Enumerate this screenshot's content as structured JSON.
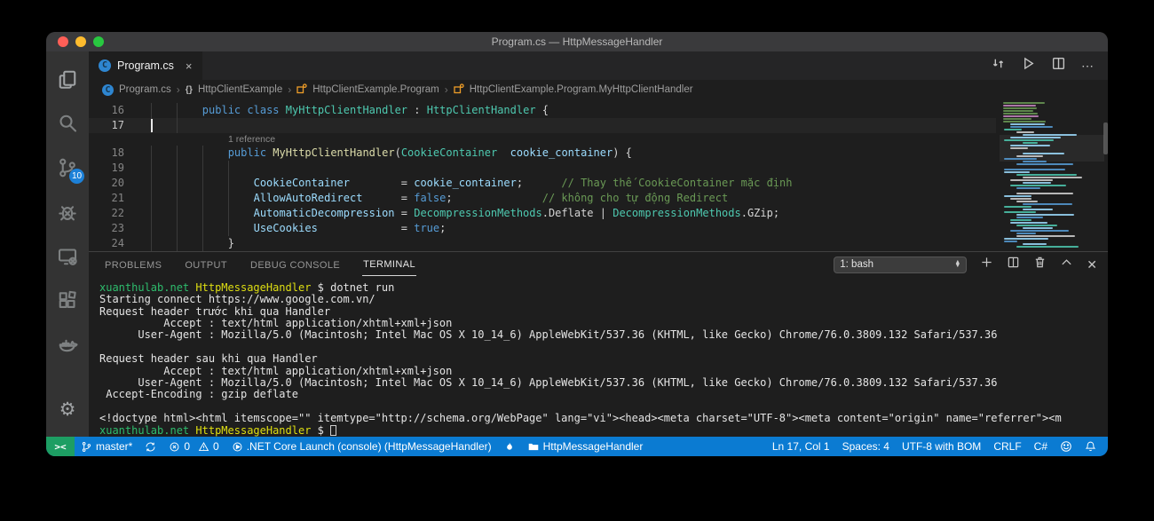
{
  "window": {
    "title": "Program.cs — HttpMessageHandler"
  },
  "tab": {
    "label": "Program.cs",
    "close": "×"
  },
  "editor_actions": {
    "more": "⋯"
  },
  "breadcrumb": {
    "file": "Program.cs",
    "namespace": "HttpClientExample",
    "cls1": "HttpClientExample.Program",
    "cls2": "HttpClientExample.Program.MyHttpClientHandler",
    "curly": "{}",
    "sep": "›"
  },
  "activity": {
    "scm_badge": "10",
    "gear": "⚙"
  },
  "editor": {
    "rows": [
      {
        "num": "16",
        "guides": 2,
        "segs": [
          [
            "pl",
            "        "
          ],
          [
            "kw",
            "public"
          ],
          [
            "pl",
            " "
          ],
          [
            "kw",
            "class"
          ],
          [
            "pl",
            " "
          ],
          [
            "ty",
            "MyHttpClientHandler"
          ],
          [
            "pl",
            " : "
          ],
          [
            "ty",
            "HttpClientHandler"
          ],
          [
            "pl",
            " {"
          ]
        ]
      },
      {
        "num": "17",
        "guides": 2,
        "active": true,
        "cursor": true,
        "segs": []
      },
      {
        "lens": "1 reference"
      },
      {
        "num": "18",
        "guides": 3,
        "segs": [
          [
            "pl",
            "            "
          ],
          [
            "kw",
            "public"
          ],
          [
            "pl",
            " "
          ],
          [
            "fn",
            "MyHttpClientHandler"
          ],
          [
            "pl",
            "("
          ],
          [
            "ty",
            "CookieContainer"
          ],
          [
            "pl",
            "  "
          ],
          [
            "var",
            "cookie_container"
          ],
          [
            "pl",
            ") {"
          ]
        ]
      },
      {
        "num": "19",
        "guides": 4,
        "segs": []
      },
      {
        "num": "20",
        "guides": 4,
        "segs": [
          [
            "pl",
            "                "
          ],
          [
            "var",
            "CookieContainer"
          ],
          [
            "pl",
            "        = "
          ],
          [
            "var",
            "cookie_container"
          ],
          [
            "pl",
            ";      "
          ],
          [
            "cm",
            "// Thay thế CookieContainer mặc định"
          ]
        ]
      },
      {
        "num": "21",
        "guides": 4,
        "segs": [
          [
            "pl",
            "                "
          ],
          [
            "var",
            "AllowAutoRedirect"
          ],
          [
            "pl",
            "      = "
          ],
          [
            "kw",
            "false"
          ],
          [
            "pl",
            ";              "
          ],
          [
            "cm",
            "// không cho tự động Redirect"
          ]
        ]
      },
      {
        "num": "22",
        "guides": 4,
        "segs": [
          [
            "pl",
            "                "
          ],
          [
            "var",
            "AutomaticDecompression"
          ],
          [
            "pl",
            " = "
          ],
          [
            "ty",
            "DecompressionMethods"
          ],
          [
            "pl",
            ".Deflate | "
          ],
          [
            "ty",
            "DecompressionMethods"
          ],
          [
            "pl",
            ".GZip;"
          ]
        ]
      },
      {
        "num": "23",
        "guides": 4,
        "segs": [
          [
            "pl",
            "                "
          ],
          [
            "var",
            "UseCookies"
          ],
          [
            "pl",
            "             = "
          ],
          [
            "kw",
            "true"
          ],
          [
            "pl",
            ";"
          ]
        ]
      },
      {
        "num": "24",
        "guides": 3,
        "segs": [
          [
            "pl",
            "            }"
          ]
        ]
      }
    ]
  },
  "panel": {
    "tabs": [
      "PROBLEMS",
      "OUTPUT",
      "DEBUG CONSOLE",
      "TERMINAL"
    ],
    "active_tab": "TERMINAL",
    "shell_select": "1: bash"
  },
  "terminal": {
    "lines": [
      {
        "segs": [
          [
            "g",
            "xuanthulab.net"
          ],
          [
            "w",
            " "
          ],
          [
            "y",
            "HttpMessageHandler"
          ],
          [
            "w",
            " $ dotnet run"
          ]
        ]
      },
      {
        "segs": [
          [
            "w",
            "Starting connect https://www.google.com.vn/"
          ]
        ]
      },
      {
        "segs": [
          [
            "w",
            "Request header trước khi qua Handler"
          ]
        ]
      },
      {
        "segs": [
          [
            "w",
            "          Accept : text/html application/xhtml+xml+json"
          ]
        ]
      },
      {
        "segs": [
          [
            "w",
            "      User-Agent : Mozilla/5.0 (Macintosh; Intel Mac OS X 10_14_6) AppleWebKit/537.36 (KHTML, like Gecko) Chrome/76.0.3809.132 Safari/537.36"
          ]
        ]
      },
      {
        "segs": []
      },
      {
        "segs": [
          [
            "w",
            "Request header sau khi qua Handler"
          ]
        ]
      },
      {
        "segs": [
          [
            "w",
            "          Accept : text/html application/xhtml+xml+json"
          ]
        ]
      },
      {
        "segs": [
          [
            "w",
            "      User-Agent : Mozilla/5.0 (Macintosh; Intel Mac OS X 10_14_6) AppleWebKit/537.36 (KHTML, like Gecko) Chrome/76.0.3809.132 Safari/537.36"
          ]
        ]
      },
      {
        "segs": [
          [
            "w",
            " Accept-Encoding : gzip deflate"
          ]
        ]
      },
      {
        "segs": []
      },
      {
        "segs": [
          [
            "w",
            "<!doctype html><html itemscope=\"\" itemtype=\"http://schema.org/WebPage\" lang=\"vi\"><head><meta charset=\"UTF-8\"><meta content=\"origin\" name=\"referrer\"><m"
          ]
        ]
      },
      {
        "segs": [
          [
            "g",
            "xuanthulab.net"
          ],
          [
            "w",
            " "
          ],
          [
            "y",
            "HttpMessageHandler"
          ],
          [
            "w",
            " $ "
          ]
        ],
        "cursor": true
      }
    ]
  },
  "status": {
    "remote": "><",
    "branch": "master*",
    "errors": "0",
    "warnings": "0",
    "debug_config": ".NET Core Launch (console) (HttpMessageHandler)",
    "folder": "HttpMessageHandler",
    "line_col": "Ln 17, Col 1",
    "indent": "Spaces: 4",
    "encoding": "UTF-8 with BOM",
    "eol": "CRLF",
    "language": "C#"
  },
  "colors": {
    "accent": "#0b7bd2",
    "remote_green": "#1d9e63",
    "traffic_red": "#ff5f57",
    "traffic_yellow": "#febc2e",
    "traffic_green": "#28c840"
  }
}
